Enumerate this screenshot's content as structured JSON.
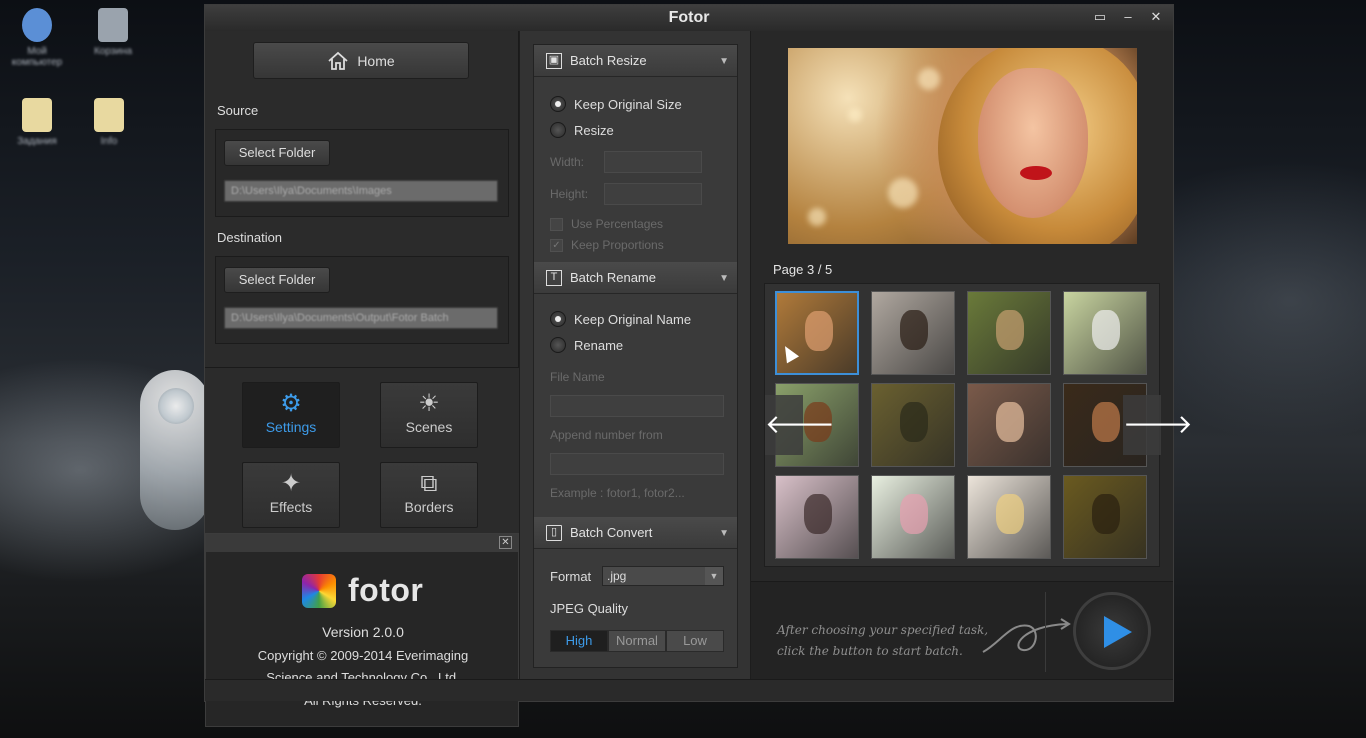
{
  "desktop": {
    "icons": [
      {
        "label": "Мой компьютер",
        "color": "#5b8fd6"
      },
      {
        "label": "Корзина",
        "color": "#9aa3ad"
      },
      {
        "label": "Задания",
        "color": "#e8d9a0"
      },
      {
        "label": "Info",
        "color": "#e8d9a0"
      }
    ]
  },
  "window": {
    "title": "Fotor",
    "controls": [
      "▭",
      "–",
      "✕"
    ]
  },
  "left": {
    "home_label": "Home",
    "source_label": "Source",
    "source_button": "Select Folder",
    "source_path": "D:\\Users\\Ilya\\Documents\\Images",
    "destination_label": "Destination",
    "destination_button": "Select Folder",
    "destination_path": "D:\\Users\\Ilya\\Documents\\Output\\Fotor Batch",
    "modes": [
      {
        "label": "Settings",
        "icon": "⚙",
        "active": true
      },
      {
        "label": "Scenes",
        "icon": "☀",
        "active": false
      },
      {
        "label": "Effects",
        "icon": "✦",
        "active": false
      },
      {
        "label": "Borders",
        "icon": "⧉",
        "active": false
      }
    ]
  },
  "about": {
    "close": "✕",
    "logo_text": "fotor",
    "version": "Version 2.0.0",
    "copyright1": "Copyright © 2009-2014 Everimaging",
    "copyright2": "Science and Technology Co., Ltd.",
    "rights": "All Rights Reserved."
  },
  "batch": {
    "resize": {
      "title": "Batch Resize",
      "option1": "Keep Original Size",
      "option2": "Resize",
      "width_label": "Width:",
      "height_label": "Height:",
      "use_percentages": "Use Percentages",
      "keep_proportions": "Keep Proportions"
    },
    "rename": {
      "title": "Batch Rename",
      "option1": "Keep Original Name",
      "option2": "Rename",
      "file_name_label": "File Name",
      "append_label": "Append number from",
      "example": "Example : fotor1, fotor2..."
    },
    "convert": {
      "title": "Batch Convert",
      "format_label": "Format",
      "format_value": ".jpg",
      "quality_label": "JPEG Quality",
      "quality_options": [
        "High",
        "Normal",
        "Low"
      ],
      "quality_selected": "High"
    }
  },
  "gallery": {
    "page_indicator": "Page 3 / 5",
    "thumbs": [
      {
        "bg": "#b07a3a",
        "fig": "#e0a070"
      },
      {
        "bg": "#b0a8a0",
        "fig": "#2a1c14"
      },
      {
        "bg": "#6a7a3a",
        "fig": "#c8a070"
      },
      {
        "bg": "#c8d4a0",
        "fig": "#f0f0f0"
      },
      {
        "bg": "#8aa06a",
        "fig": "#7a3a1a"
      },
      {
        "bg": "#6a6030",
        "fig": "#2a2a1a"
      },
      {
        "bg": "#7a5a4a",
        "fig": "#e8c0a0"
      },
      {
        "bg": "#3a2a1a",
        "fig": "#c07a4a"
      },
      {
        "bg": "#d8c0c8",
        "fig": "#3a2a2a"
      },
      {
        "bg": "#e8efe0",
        "fig": "#e8a0b0"
      },
      {
        "bg": "#ece4da",
        "fig": "#f0d080"
      },
      {
        "bg": "#6a5a20",
        "fig": "#2a2010"
      }
    ],
    "prev_label": "🡐",
    "next_label": "🡒",
    "hint_line1": "After choosing your specified task,",
    "hint_line2": "click the button to start batch.",
    "accent": "#3d8fd8"
  }
}
